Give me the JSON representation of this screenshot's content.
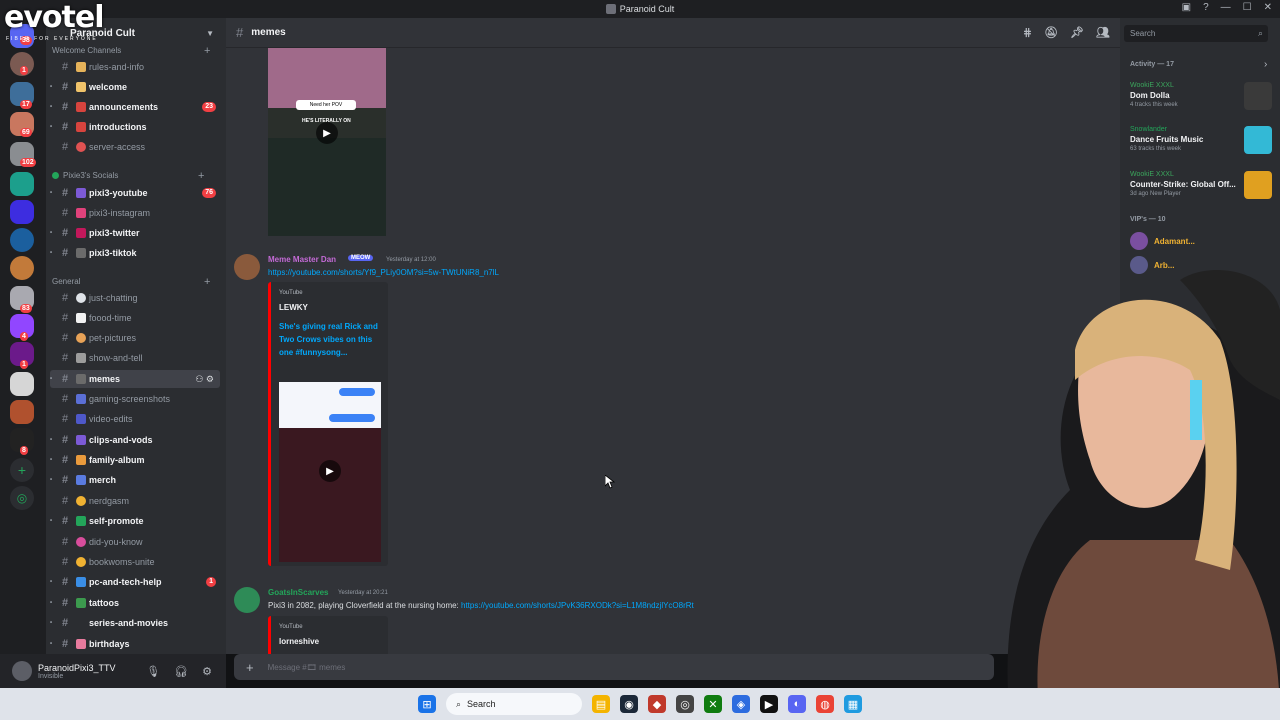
{
  "window": {
    "title": "Paranoid Cult",
    "icons": [
      "inbox-icon",
      "help-icon",
      "minimize-icon",
      "maximize-icon",
      "close-icon"
    ]
  },
  "watermark": {
    "brand": "evotel",
    "tagline": "FIBER FOR EVERYONE"
  },
  "server": {
    "name": "Paranoid Cult",
    "rail_badges": [
      "38",
      "1",
      "17",
      "69",
      "102",
      "83",
      "4",
      "1",
      "8"
    ]
  },
  "sidebar": {
    "categories": [
      {
        "label": "Welcome Channels"
      },
      {
        "label": "Pixie3's Socials"
      },
      {
        "label": "General"
      }
    ],
    "channels": [
      {
        "name": "rules-and-info",
        "unread": false,
        "badge": ""
      },
      {
        "name": "welcome",
        "unread": true,
        "badge": ""
      },
      {
        "name": "announcements",
        "unread": true,
        "badge": "23"
      },
      {
        "name": "introductions",
        "unread": true,
        "badge": ""
      },
      {
        "name": "server-access",
        "unread": false,
        "badge": ""
      },
      {
        "name": "pixi3-youtube",
        "unread": true,
        "badge": "76"
      },
      {
        "name": "pixi3-instagram",
        "unread": false,
        "badge": ""
      },
      {
        "name": "pixi3-twitter",
        "unread": true,
        "badge": ""
      },
      {
        "name": "pixi3-tiktok",
        "unread": true,
        "badge": ""
      },
      {
        "name": "just-chatting",
        "unread": false,
        "badge": ""
      },
      {
        "name": "foood-time",
        "unread": false,
        "badge": ""
      },
      {
        "name": "pet-pictures",
        "unread": false,
        "badge": ""
      },
      {
        "name": "show-and-tell",
        "unread": false,
        "badge": ""
      },
      {
        "name": "memes",
        "unread": true,
        "badge": ""
      },
      {
        "name": "gaming-screenshots",
        "unread": false,
        "badge": ""
      },
      {
        "name": "video-edits",
        "unread": false,
        "badge": ""
      },
      {
        "name": "clips-and-vods",
        "unread": true,
        "badge": ""
      },
      {
        "name": "family-album",
        "unread": true,
        "badge": ""
      },
      {
        "name": "merch",
        "unread": true,
        "badge": ""
      },
      {
        "name": "nerdgasm",
        "unread": false,
        "badge": ""
      },
      {
        "name": "self-promote",
        "unread": true,
        "badge": ""
      },
      {
        "name": "did-you-know",
        "unread": false,
        "badge": ""
      },
      {
        "name": "bookwoms-unite",
        "unread": false,
        "badge": ""
      },
      {
        "name": "pc-and-tech-help",
        "unread": true,
        "badge": "1"
      },
      {
        "name": "tattoos",
        "unread": true,
        "badge": ""
      },
      {
        "name": "series-and-movies",
        "unread": true,
        "badge": ""
      },
      {
        "name": "birthdays",
        "unread": true,
        "badge": ""
      }
    ]
  },
  "user": {
    "name": "ParanoidPixi3_TTV",
    "status": "Invisible"
  },
  "chat": {
    "channel": "memes",
    "messages": [
      {
        "author": "Meme Master Dan",
        "tag": "MEOW",
        "time": "Yesterday at 12:00",
        "link": "https://youtube.com/shorts/Yf9_PLiy0OM?si=5w-TWtUNiR8_n7lL",
        "embed": {
          "provider": "YouTube",
          "title": "LEWKY",
          "description": "She's giving real Rick and Two Crows vibes on this one #funnysong..."
        }
      },
      {
        "author": "GoatsInScarves",
        "tag": "",
        "time": "Yesterday at 20:21",
        "text": "Pixi3 in 2082, playing Cloverfield at the nursing home: ",
        "link": "https://youtube.com/shorts/JPvK36RXODk?si=L1M8ndzjlYcO8rRt",
        "embed": {
          "provider": "YouTube",
          "title": "lorneshive"
        }
      }
    ],
    "thumb_caption": "HE'S LITERALLY ON",
    "thumb_overlay": "Need her POV"
  },
  "composer": {
    "placeholder": "Message #🎞 memes"
  },
  "member_panel": {
    "search_placeholder": "Search",
    "activity_header": "Activity — 17",
    "activities": [
      {
        "user": "WookiE XXXL",
        "title": "Dom Dolla",
        "meta": "4 tracks this week"
      },
      {
        "user": "Snowlander",
        "title": "Dance Fruits Music",
        "meta": "63 tracks this week"
      },
      {
        "user": "WookiE XXXL",
        "title": "Counter-Strike: Global Off...",
        "meta": "3d ago  New Player"
      }
    ],
    "vip_header": "VIP's — 10",
    "vips": [
      "Adamant...",
      "Arb..."
    ]
  },
  "taskbar": {
    "search": "Search"
  }
}
